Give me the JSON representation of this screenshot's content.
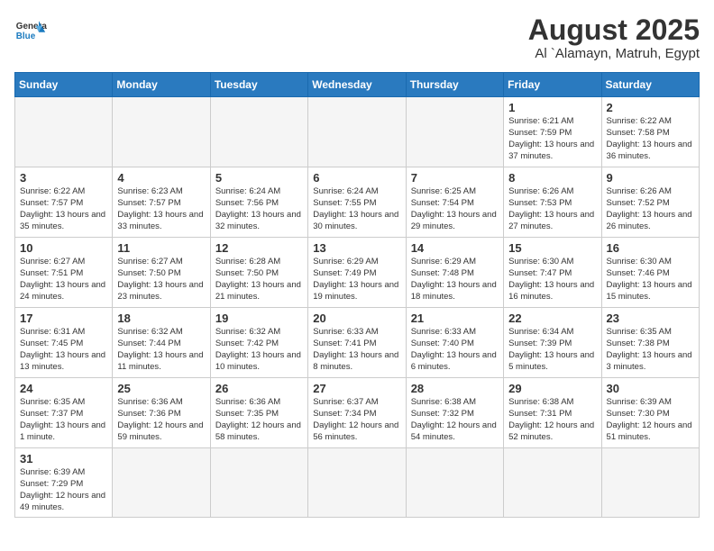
{
  "logo": {
    "text_general": "General",
    "text_blue": "Blue"
  },
  "title": "August 2025",
  "subtitle": "Al `Alamayn, Matruh, Egypt",
  "days_of_week": [
    "Sunday",
    "Monday",
    "Tuesday",
    "Wednesday",
    "Thursday",
    "Friday",
    "Saturday"
  ],
  "weeks": [
    [
      {
        "day": null,
        "info": null
      },
      {
        "day": null,
        "info": null
      },
      {
        "day": null,
        "info": null
      },
      {
        "day": null,
        "info": null
      },
      {
        "day": null,
        "info": null
      },
      {
        "day": "1",
        "info": "Sunrise: 6:21 AM\nSunset: 7:59 PM\nDaylight: 13 hours and 37 minutes."
      },
      {
        "day": "2",
        "info": "Sunrise: 6:22 AM\nSunset: 7:58 PM\nDaylight: 13 hours and 36 minutes."
      }
    ],
    [
      {
        "day": "3",
        "info": "Sunrise: 6:22 AM\nSunset: 7:57 PM\nDaylight: 13 hours and 35 minutes."
      },
      {
        "day": "4",
        "info": "Sunrise: 6:23 AM\nSunset: 7:57 PM\nDaylight: 13 hours and 33 minutes."
      },
      {
        "day": "5",
        "info": "Sunrise: 6:24 AM\nSunset: 7:56 PM\nDaylight: 13 hours and 32 minutes."
      },
      {
        "day": "6",
        "info": "Sunrise: 6:24 AM\nSunset: 7:55 PM\nDaylight: 13 hours and 30 minutes."
      },
      {
        "day": "7",
        "info": "Sunrise: 6:25 AM\nSunset: 7:54 PM\nDaylight: 13 hours and 29 minutes."
      },
      {
        "day": "8",
        "info": "Sunrise: 6:26 AM\nSunset: 7:53 PM\nDaylight: 13 hours and 27 minutes."
      },
      {
        "day": "9",
        "info": "Sunrise: 6:26 AM\nSunset: 7:52 PM\nDaylight: 13 hours and 26 minutes."
      }
    ],
    [
      {
        "day": "10",
        "info": "Sunrise: 6:27 AM\nSunset: 7:51 PM\nDaylight: 13 hours and 24 minutes."
      },
      {
        "day": "11",
        "info": "Sunrise: 6:27 AM\nSunset: 7:50 PM\nDaylight: 13 hours and 23 minutes."
      },
      {
        "day": "12",
        "info": "Sunrise: 6:28 AM\nSunset: 7:50 PM\nDaylight: 13 hours and 21 minutes."
      },
      {
        "day": "13",
        "info": "Sunrise: 6:29 AM\nSunset: 7:49 PM\nDaylight: 13 hours and 19 minutes."
      },
      {
        "day": "14",
        "info": "Sunrise: 6:29 AM\nSunset: 7:48 PM\nDaylight: 13 hours and 18 minutes."
      },
      {
        "day": "15",
        "info": "Sunrise: 6:30 AM\nSunset: 7:47 PM\nDaylight: 13 hours and 16 minutes."
      },
      {
        "day": "16",
        "info": "Sunrise: 6:30 AM\nSunset: 7:46 PM\nDaylight: 13 hours and 15 minutes."
      }
    ],
    [
      {
        "day": "17",
        "info": "Sunrise: 6:31 AM\nSunset: 7:45 PM\nDaylight: 13 hours and 13 minutes."
      },
      {
        "day": "18",
        "info": "Sunrise: 6:32 AM\nSunset: 7:44 PM\nDaylight: 13 hours and 11 minutes."
      },
      {
        "day": "19",
        "info": "Sunrise: 6:32 AM\nSunset: 7:42 PM\nDaylight: 13 hours and 10 minutes."
      },
      {
        "day": "20",
        "info": "Sunrise: 6:33 AM\nSunset: 7:41 PM\nDaylight: 13 hours and 8 minutes."
      },
      {
        "day": "21",
        "info": "Sunrise: 6:33 AM\nSunset: 7:40 PM\nDaylight: 13 hours and 6 minutes."
      },
      {
        "day": "22",
        "info": "Sunrise: 6:34 AM\nSunset: 7:39 PM\nDaylight: 13 hours and 5 minutes."
      },
      {
        "day": "23",
        "info": "Sunrise: 6:35 AM\nSunset: 7:38 PM\nDaylight: 13 hours and 3 minutes."
      }
    ],
    [
      {
        "day": "24",
        "info": "Sunrise: 6:35 AM\nSunset: 7:37 PM\nDaylight: 13 hours and 1 minute."
      },
      {
        "day": "25",
        "info": "Sunrise: 6:36 AM\nSunset: 7:36 PM\nDaylight: 12 hours and 59 minutes."
      },
      {
        "day": "26",
        "info": "Sunrise: 6:36 AM\nSunset: 7:35 PM\nDaylight: 12 hours and 58 minutes."
      },
      {
        "day": "27",
        "info": "Sunrise: 6:37 AM\nSunset: 7:34 PM\nDaylight: 12 hours and 56 minutes."
      },
      {
        "day": "28",
        "info": "Sunrise: 6:38 AM\nSunset: 7:32 PM\nDaylight: 12 hours and 54 minutes."
      },
      {
        "day": "29",
        "info": "Sunrise: 6:38 AM\nSunset: 7:31 PM\nDaylight: 12 hours and 52 minutes."
      },
      {
        "day": "30",
        "info": "Sunrise: 6:39 AM\nSunset: 7:30 PM\nDaylight: 12 hours and 51 minutes."
      }
    ],
    [
      {
        "day": "31",
        "info": "Sunrise: 6:39 AM\nSunset: 7:29 PM\nDaylight: 12 hours and 49 minutes."
      },
      {
        "day": null,
        "info": null
      },
      {
        "day": null,
        "info": null
      },
      {
        "day": null,
        "info": null
      },
      {
        "day": null,
        "info": null
      },
      {
        "day": null,
        "info": null
      },
      {
        "day": null,
        "info": null
      }
    ]
  ]
}
